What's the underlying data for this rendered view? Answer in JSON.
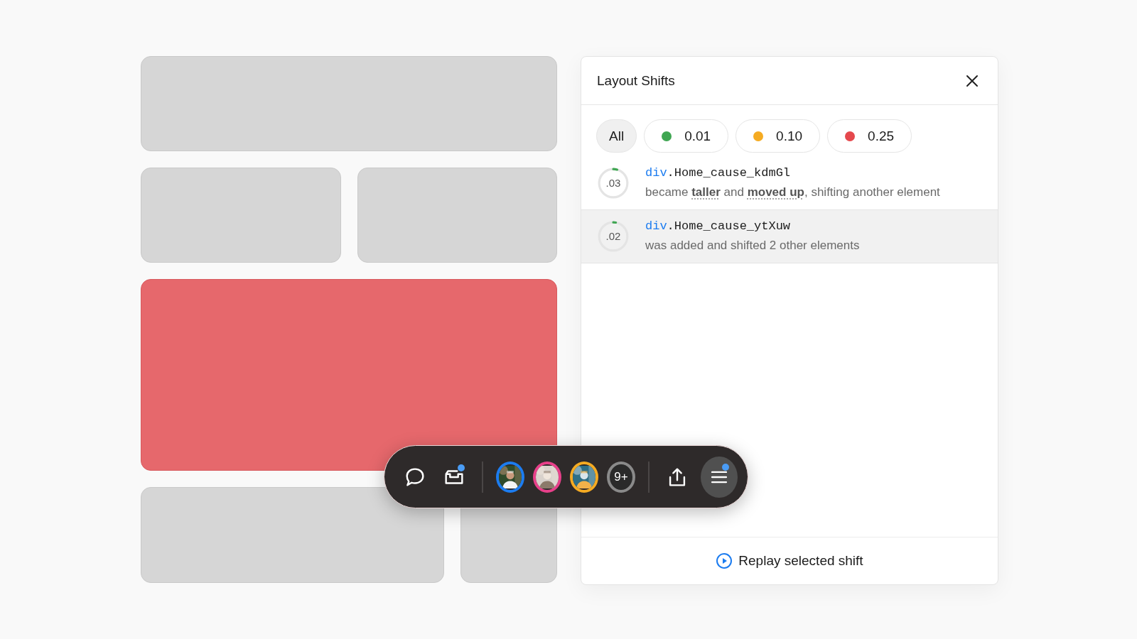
{
  "canvas": {
    "tiles": [
      {
        "kind": "plain"
      },
      {
        "kind": "plain"
      },
      {
        "kind": "plain"
      },
      {
        "kind": "highlight"
      },
      {
        "kind": "plain"
      },
      {
        "kind": "plain"
      }
    ]
  },
  "panel": {
    "title": "Layout Shifts",
    "filters": [
      {
        "label": "All",
        "selected": true
      },
      {
        "label": "0.01",
        "color": "#3fa652",
        "selected": false
      },
      {
        "label": "0.10",
        "color": "#f5ab22",
        "selected": false
      },
      {
        "label": "0.25",
        "color": "#e5484d",
        "selected": false
      }
    ],
    "shifts": [
      {
        "score": ".03",
        "level": 0.03,
        "tag": "div",
        "class_name": ".Home_cause_kdmGl",
        "description": "became **taller** and **moved up**, shifting another element",
        "selected": false
      },
      {
        "score": ".02",
        "level": 0.02,
        "tag": "div",
        "class_name": ".Home_cause_ytXuw",
        "description": "was added and shifted 2 other elements",
        "selected": true
      }
    ],
    "replay_button": "Replay selected shift"
  },
  "toolbar": {
    "inbox_badge": true,
    "menu_badge": true,
    "overflow": "9+"
  }
}
